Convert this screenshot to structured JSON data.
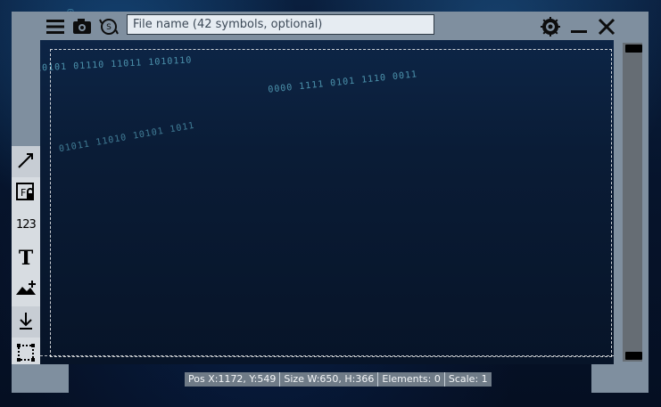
{
  "toolbar": {
    "filename_placeholder": "File name (42 symbols, optional)"
  },
  "tools": [
    {
      "name": "arrow",
      "icon": "arrow-diagonal-icon"
    },
    {
      "name": "obfuscate",
      "icon": "lock-field-icon"
    },
    {
      "name": "number",
      "icon": "number-icon",
      "text": "123"
    },
    {
      "name": "text",
      "icon": "text-icon",
      "text": "T"
    },
    {
      "name": "image",
      "icon": "image-add-icon"
    },
    {
      "name": "save",
      "icon": "download-icon"
    },
    {
      "name": "selection",
      "icon": "selection-icon"
    }
  ],
  "status": {
    "pos": "Pos X:1172, Y:549",
    "size": "Size W:650, H:366",
    "elements": "Elements: 0",
    "scale": "Scale: 1"
  },
  "colors": {
    "frame": "#7f8f9f",
    "toolbox": "#d7dce1",
    "canvas": "#0a1c36"
  }
}
